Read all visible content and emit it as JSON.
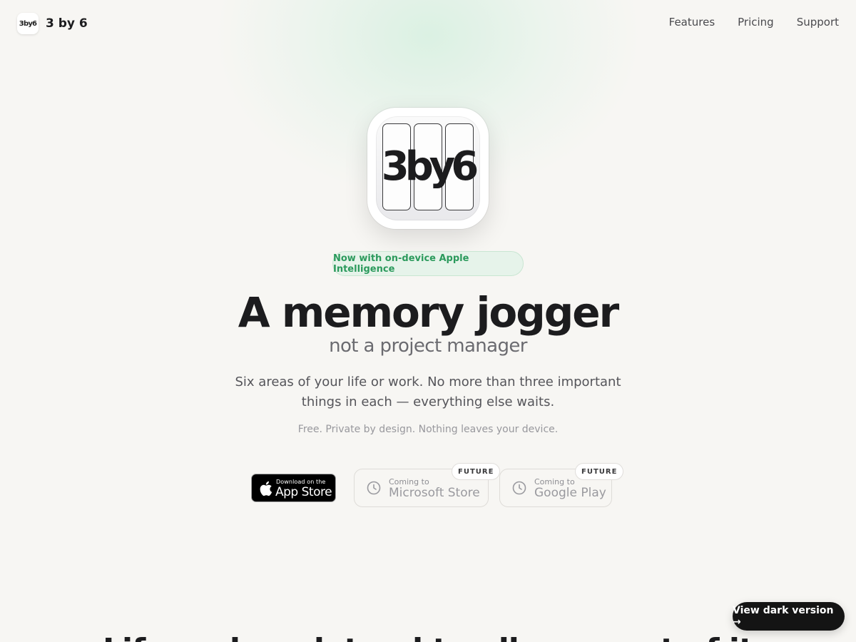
{
  "header": {
    "brand_logo_text": "3by6",
    "brand_name": "3 by 6",
    "nav": [
      "Features",
      "Pricing",
      "Support"
    ]
  },
  "hero": {
    "app_icon_text": "3by6",
    "badge": "Now with on-device Apple Intelligence",
    "headline": "A memory jogger",
    "subheadline": "not a project manager",
    "description": "Six areas of your life or work. No more than three important things in each — everything else waits.",
    "note": "Free. Private by design. Nothing leaves your device."
  },
  "stores": {
    "app_store": {
      "small": "Download on the",
      "big": "App Store"
    },
    "microsoft": {
      "small": "Coming to",
      "big": "Microsoft Store",
      "tag": "FUTURE"
    },
    "google": {
      "small": "Coming to",
      "big": "Google Play",
      "tag": "FUTURE"
    }
  },
  "dark_button": "View dark version →",
  "peek_text": "Life and work tend to all pour out of it"
}
